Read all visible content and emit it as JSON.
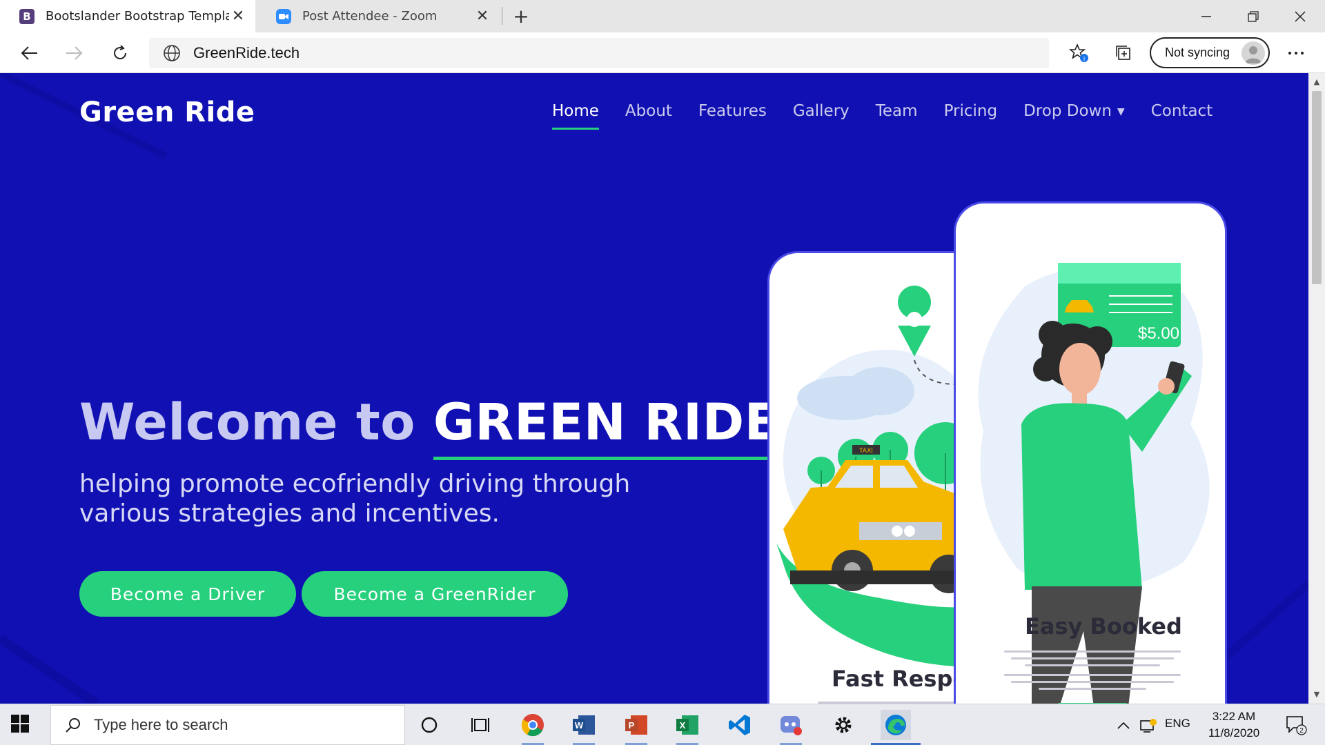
{
  "browser": {
    "tabs": [
      {
        "title": "Bootslander Bootstrap Template",
        "favicon": "B",
        "favicon_color": "#563d7c",
        "active": true
      },
      {
        "title": "Post Attendee - Zoom",
        "favicon": "zoom-icon",
        "favicon_color": "#2d8cff",
        "active": false
      }
    ],
    "url": "GreenRide.tech",
    "sync_label": "Not syncing"
  },
  "site": {
    "brand": "Green Ride",
    "nav": [
      {
        "label": "Home",
        "active": true
      },
      {
        "label": "About"
      },
      {
        "label": "Features"
      },
      {
        "label": "Gallery"
      },
      {
        "label": "Team"
      },
      {
        "label": "Pricing"
      },
      {
        "label": "Drop Down",
        "dropdown": true
      },
      {
        "label": "Contact"
      }
    ],
    "hero": {
      "title_prefix": "Welcome to ",
      "title_highlight": "GREEN RIDE",
      "subtitle": "helping promote ecofriendly driving through various strategies and incentives.",
      "buttons": [
        "Become a Driver",
        "Become a GreenRider"
      ]
    },
    "phones": {
      "left_title": "Fast Respon",
      "right_title": "Easy Booked",
      "price": "$5.00",
      "taxi_sign": "TAXI"
    },
    "colors": {
      "background": "#1111b3",
      "accent": "#26d07c",
      "phone_border": "#4a4ae6"
    }
  },
  "taskbar": {
    "search_placeholder": "Type here to search",
    "language": "ENG",
    "time": "3:22 AM",
    "date": "11/8/2020",
    "notifications": "2",
    "apps": [
      "cortana-icon",
      "task-view-icon",
      "chrome-icon",
      "word-icon",
      "powerpoint-icon",
      "excel-icon",
      "vscode-icon",
      "discord-icon",
      "settings-icon",
      "edge-icon"
    ]
  }
}
